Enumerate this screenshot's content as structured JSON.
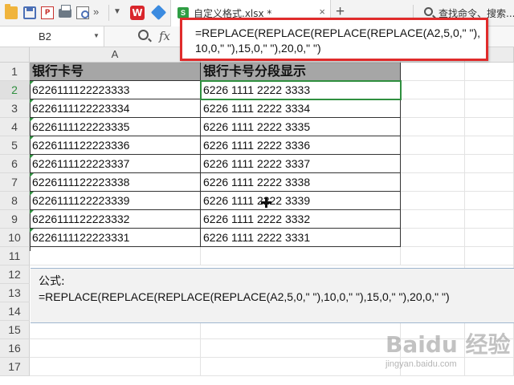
{
  "toolbar": {
    "more_glyph": "»",
    "dropdown_glyph": "▼",
    "wps_logo": "W",
    "pdf_label": "P"
  },
  "tab": {
    "title": "自定义格式.xlsx *",
    "close_glyph": "×",
    "add_glyph": "+"
  },
  "search": {
    "text": "查找命令、搜索..."
  },
  "formula_bar": {
    "cell_ref": "B2",
    "fx_label": "fx",
    "formula": "=REPLACE(REPLACE(REPLACE(REPLACE(A2,5,0,\" \"),10,0,\" \"),15,0,\" \"),20,0,\" \")"
  },
  "grid": {
    "columns": [
      "A"
    ],
    "rows": [
      "1",
      "2",
      "3",
      "4",
      "5",
      "6",
      "7",
      "8",
      "9",
      "10",
      "11",
      "12",
      "13",
      "14",
      "15",
      "16",
      "17"
    ],
    "active_row": "2",
    "header_a": "银行卡号",
    "header_b": "银行卡号分段显示",
    "data": [
      {
        "a": "6226111122223333",
        "b": "6226 1111 2222 3333"
      },
      {
        "a": "6226111122223334",
        "b": "6226 1111 2222 3334"
      },
      {
        "a": "6226111122223335",
        "b": "6226 1111 2222 3335"
      },
      {
        "a": "6226111122223336",
        "b": "6226 1111 2222 3336"
      },
      {
        "a": "6226111122223337",
        "b": "6226 1111 2222 3337"
      },
      {
        "a": "6226111122223338",
        "b": "6226 1111 2222 3338"
      },
      {
        "a": "6226111122223339",
        "b": "6226 1111 2222 3339"
      },
      {
        "a": "6226111122223332",
        "b": "6226 1111 2222 3332"
      },
      {
        "a": "6226111122223331",
        "b": "6226 1111 2222 3331"
      }
    ]
  },
  "note": {
    "label": "公式:",
    "formula": "=REPLACE(REPLACE(REPLACE(REPLACE(A2,5,0,\" \"),10,0,\" \"),15,0,\" \"),20,0,\" \")"
  },
  "watermark": {
    "logo": "Baidu 经验",
    "sub": "jingyan.baidu.com"
  },
  "colors": {
    "accent_green": "#2f8f3f",
    "highlight_red": "#e02b2b",
    "header_fill": "#a6a6a6"
  }
}
